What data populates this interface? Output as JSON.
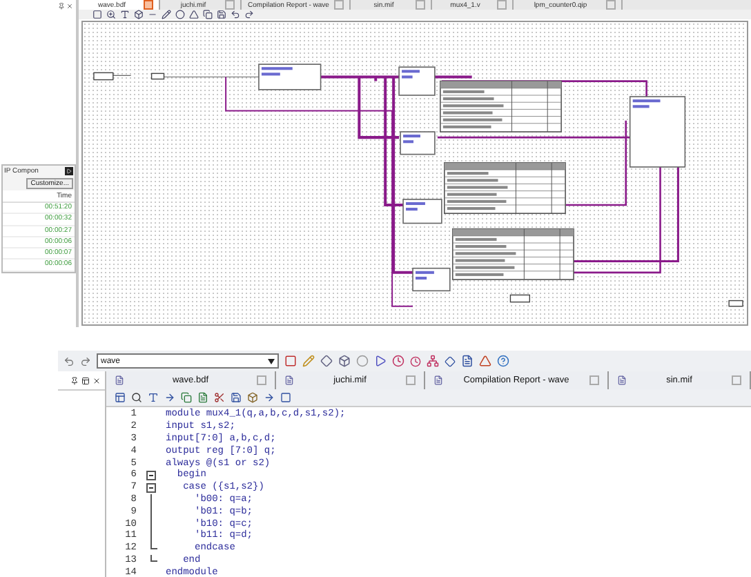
{
  "schematic_window": {
    "tabs": [
      {
        "label": "wave.bdf",
        "selected": true
      },
      {
        "label": "juchi.mif",
        "selected": false
      },
      {
        "label": "Compilation Report - wave",
        "selected": false
      },
      {
        "label": "sin.mif",
        "selected": false
      },
      {
        "label": "mux4_1.v",
        "selected": false
      },
      {
        "label": "lpm_counter0.qip",
        "selected": false
      }
    ]
  },
  "ip_panel": {
    "title": "IP Compon",
    "button": "Customize...",
    "time_header": "Time",
    "times": [
      "00:51:20",
      "00:00:32",
      "00:00:27",
      "00:00:06",
      "00:00:07",
      "00:00:06"
    ]
  },
  "editor_window": {
    "project": "wave",
    "tabs": [
      {
        "label": "wave.bdf",
        "selected": false
      },
      {
        "label": "juchi.mif",
        "selected": false
      },
      {
        "label": "Compilation Report - wave",
        "selected": false
      },
      {
        "label": "sin.mif",
        "selected": false
      }
    ],
    "code_lines": [
      {
        "number": "1",
        "text": "module mux4_1(q,a,b,c,d,s1,s2);",
        "kind": "plain"
      },
      {
        "number": "2",
        "text": "input s1,s2;",
        "kind": "plain"
      },
      {
        "number": "3",
        "text": "input[7:0] a,b,c,d;",
        "kind": "plain"
      },
      {
        "number": "4",
        "text": "output reg [7:0] q;",
        "kind": "plain"
      },
      {
        "number": "5",
        "text": "always @(s1 or s2)",
        "kind": "plain"
      },
      {
        "number": "6",
        "text": "  begin",
        "kind": "fold_start"
      },
      {
        "number": "7",
        "text": "   case ({s1,s2})",
        "kind": "fold_start"
      },
      {
        "number": "8",
        "text": "     'b00: q=a;",
        "kind": "fold_inner"
      },
      {
        "number": "9",
        "text": "     'b01: q=b;",
        "kind": "fold_inner"
      },
      {
        "number": "10",
        "text": "     'b10: q=c;",
        "kind": "fold_inner"
      },
      {
        "number": "11",
        "text": "     'b11: q=d;",
        "kind": "fold_inner"
      },
      {
        "number": "12",
        "text": "     endcase",
        "kind": "fold_end"
      },
      {
        "number": "13",
        "text": "   end",
        "kind": "fold_end"
      },
      {
        "number": "14",
        "text": "endmodule",
        "kind": "plain"
      }
    ]
  }
}
